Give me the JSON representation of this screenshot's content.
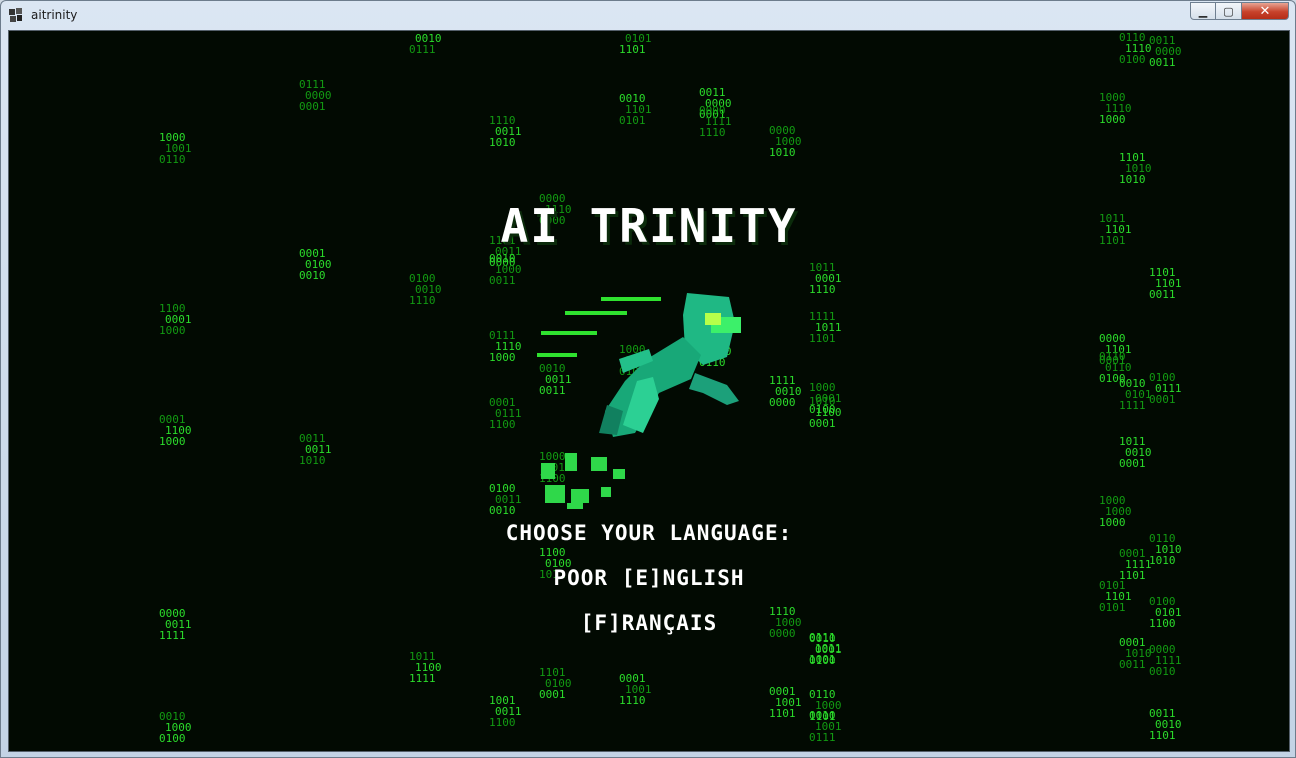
{
  "window": {
    "title": "aitrinity",
    "minimize_glyph": "▁",
    "maximize_glyph": "▢",
    "close_glyph": "✕"
  },
  "game": {
    "title": "AI TRINITY",
    "prompt": "CHOOSE YOUR LANGUAGE:",
    "options": [
      "POOR [E]NGLISH",
      "[F]RANÇAIS"
    ],
    "rain_glyphs": "01",
    "colors": {
      "background": "#020a02",
      "rain_bright": "#2bdc2b",
      "rain_dim": "#129a12",
      "text": "#ffffff",
      "hero": "#1fb884",
      "speed_lines": "#2fe22f"
    }
  }
}
